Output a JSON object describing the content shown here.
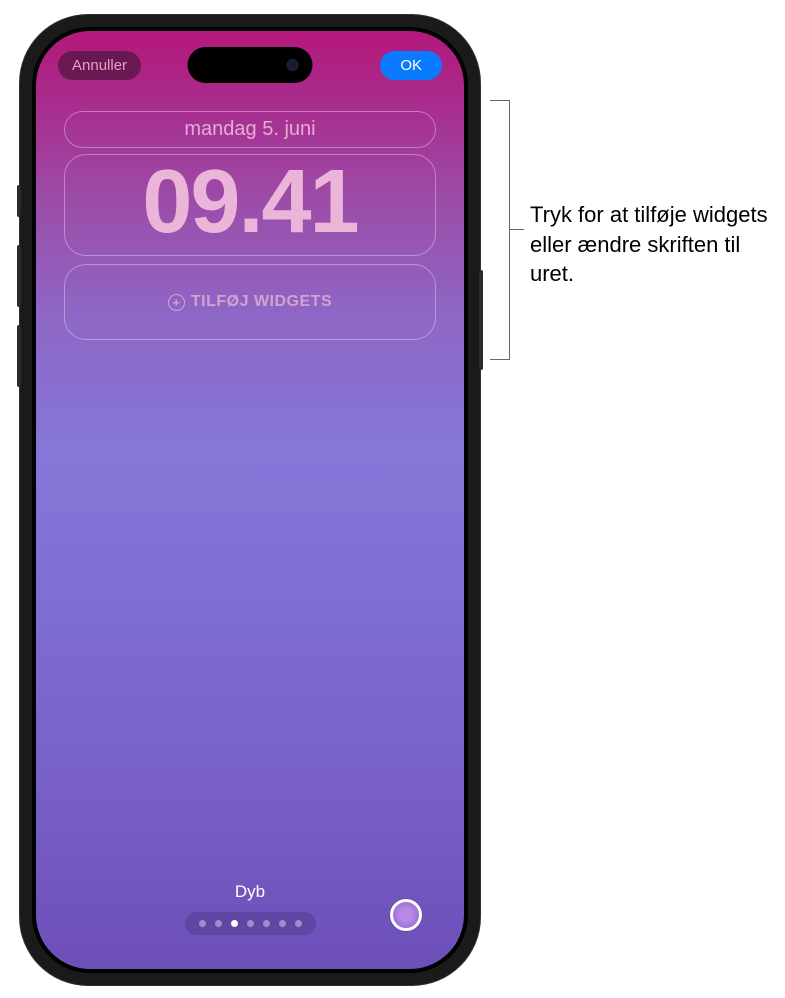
{
  "topbar": {
    "cancel_label": "Annuller",
    "ok_label": "OK"
  },
  "lockscreen": {
    "date": "mandag 5. juni",
    "time": "09.41",
    "add_widgets_label": "TILFØJ WIDGETS"
  },
  "bottom": {
    "style_name": "Dyb",
    "page_count": 7,
    "active_page_index": 2
  },
  "callout": {
    "text": "Tryk for at tilføje widgets eller ændre skriften til uret."
  }
}
